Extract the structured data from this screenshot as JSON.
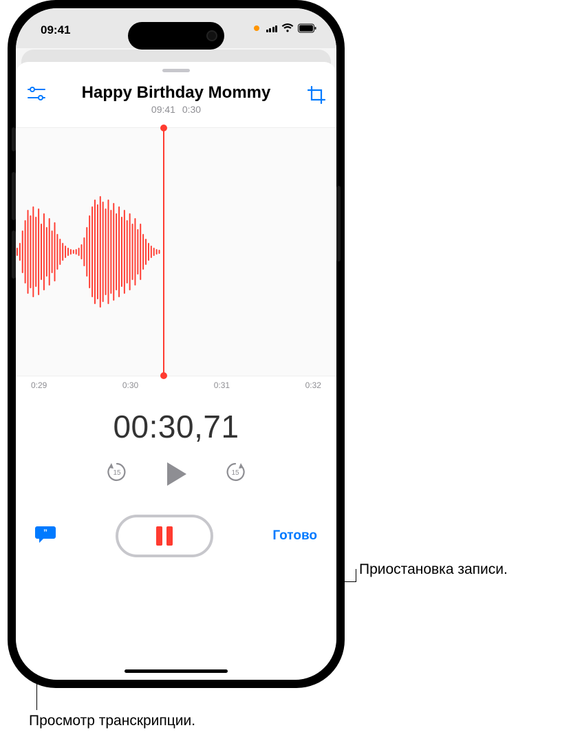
{
  "status": {
    "time": "09:41"
  },
  "recording": {
    "title": "Happy Birthday Mommy",
    "timestamp": "09:41",
    "duration": "0:30",
    "elapsed": "00:30,71"
  },
  "ruler": {
    "t0": "0:29",
    "t1": "0:30",
    "t2": "0:31",
    "t3": "0:32"
  },
  "buttons": {
    "done": "Готово"
  },
  "callouts": {
    "pause": "Приостановка записи.",
    "transcript": "Просмотр транскрипции."
  },
  "colors": {
    "accent": "#007aff",
    "record": "#ff3b30"
  }
}
